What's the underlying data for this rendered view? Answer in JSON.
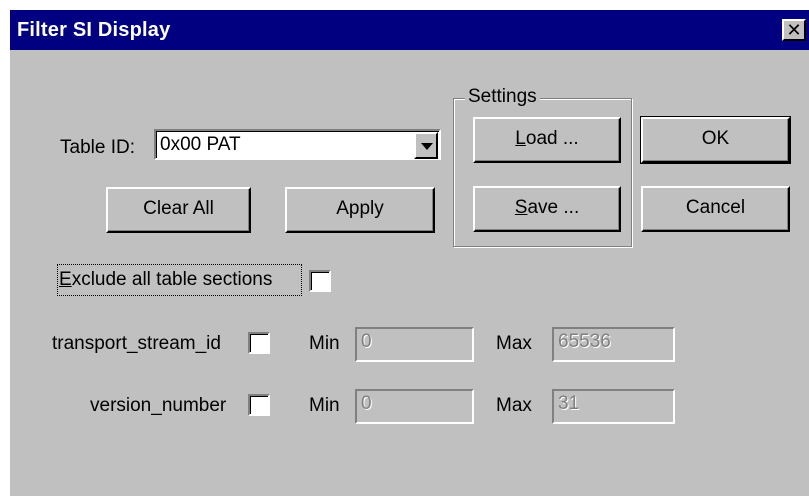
{
  "window": {
    "title": "Filter SI Display",
    "close_glyph": "✕"
  },
  "table_id": {
    "label": "Table ID:",
    "selected": "0x00 PAT"
  },
  "buttons": {
    "clear_all": "Clear All",
    "apply": "Apply",
    "ok": "OK",
    "cancel": "Cancel"
  },
  "settings": {
    "label": "Settings",
    "load": {
      "mnemonic": "L",
      "rest": "oad ..."
    },
    "save": {
      "mnemonic": "S",
      "rest": "ave ..."
    }
  },
  "exclude": {
    "mnemonic": "E",
    "rest": "xclude all table sections",
    "checked": false
  },
  "filters": [
    {
      "name": "transport_stream_id",
      "checked": false,
      "min_label": "Min",
      "min_value": "0",
      "max_label": "Max",
      "max_value": "65536"
    },
    {
      "name": "version_number",
      "checked": false,
      "min_label": "Min",
      "min_value": "0",
      "max_label": "Max",
      "max_value": "31"
    }
  ],
  "colors": {
    "titlebar": "#000080",
    "dialog_bg": "#c0c0c0"
  }
}
